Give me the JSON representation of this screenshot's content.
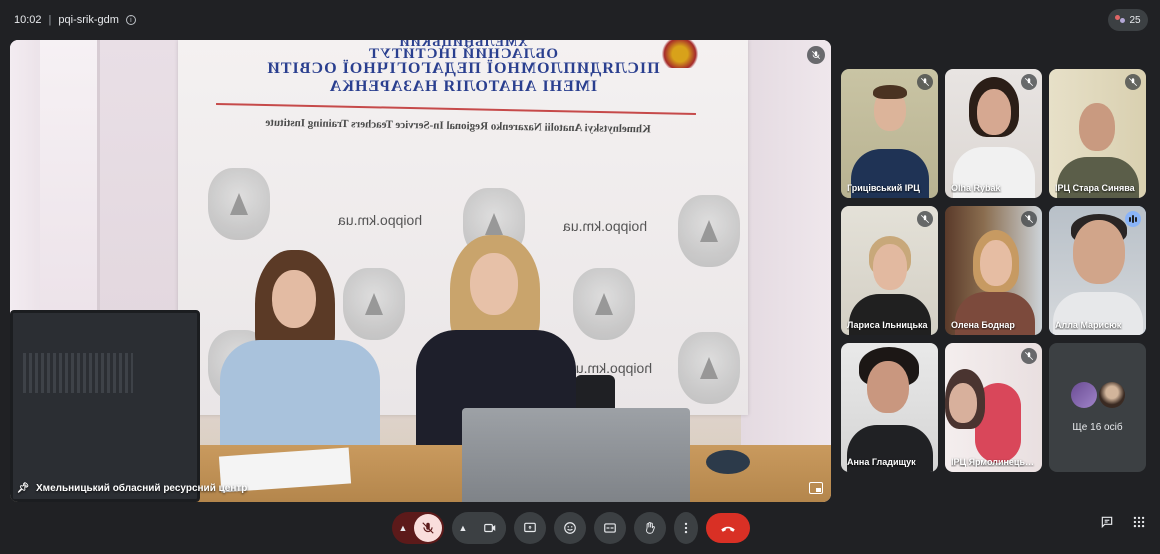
{
  "header": {
    "time": "10:02",
    "separator": "|",
    "meeting_code": "pqi-srik-gdm",
    "participant_count": "25"
  },
  "stage": {
    "name": "Хмельницький обласний ресурсний центр",
    "banner": {
      "line1": "ХМЕЛЬНИЦЬКИЙ",
      "line2": "ОБЛАСНИЙ ІНСТИТУТ",
      "line3": "ПІСЛЯДИПЛОМНОЇ ПЕДАГОГІЧНОЇ ОСВІТИ",
      "line4": "ІМЕНІ АНАТОЛІЯ НАЗАРЕНКА",
      "english": "Khmelnytskyi Anatolii Nazarenko Regional In-Service Teachers Training Institute",
      "url": "hoippo.km.ua"
    }
  },
  "tiles": [
    {
      "name": "Грицівський ІРЦ",
      "muted": true
    },
    {
      "name": "Olha Rybak",
      "muted": true
    },
    {
      "name": "ІРЦ Стара Синява",
      "muted": true
    },
    {
      "name": "Лариса Ільницька",
      "muted": true
    },
    {
      "name": "Олена Боднар",
      "muted": true
    },
    {
      "name": "Алла Марисюк",
      "muted": false
    },
    {
      "name": "Анна Гладищук",
      "muted": false
    },
    {
      "name": "ІРЦ Ярмолинецький",
      "muted": true
    }
  ],
  "more": {
    "label": "Ще 16 осіб"
  },
  "colors": {
    "background": "#202124",
    "end_call": "#d93025",
    "speaking": "#8ab4f8",
    "muted_mic_bg": "#f9dedc"
  },
  "controls": {
    "icons": [
      "chevron-up-icon",
      "mic-off-icon",
      "chevron-up-icon",
      "camera-icon",
      "present-icon",
      "emoji-icon",
      "captions-icon",
      "hand-icon",
      "more-vert-icon",
      "call-end-icon"
    ]
  },
  "side_icons": [
    "chat-icon",
    "activities-icon"
  ]
}
